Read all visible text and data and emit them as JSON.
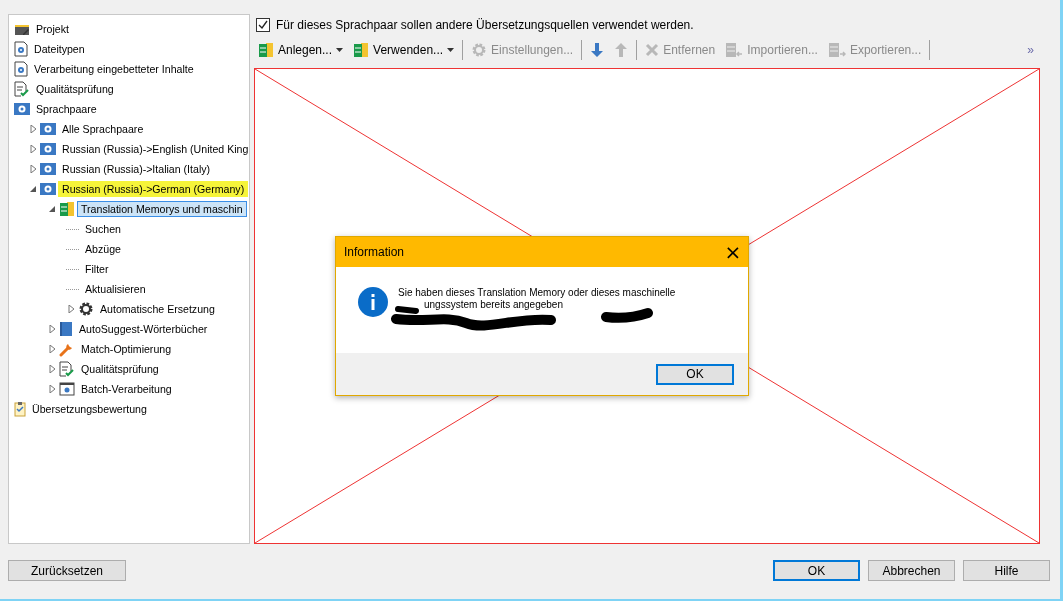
{
  "tree": [
    {
      "label": "Projekt",
      "kind": "project",
      "selected": false
    },
    {
      "label": "Dateitypen",
      "kind": "settings-doc",
      "selected": false
    },
    {
      "label": "Verarbeitung eingebetteter Inhalte",
      "kind": "settings-doc",
      "selected": false
    },
    {
      "label": "Qualitätsprüfung",
      "kind": "check-doc",
      "selected": false
    },
    {
      "label": "Sprachpaare",
      "kind": "pair",
      "selected": false,
      "children": [
        {
          "label": "Alle Sprachpaare",
          "kind": "pair",
          "expanded": false,
          "selected": false,
          "highlighted": false
        },
        {
          "label": "Russian (Russia)->English (United King",
          "kind": "pair",
          "expanded": false,
          "selected": false,
          "highlighted": false
        },
        {
          "label": "Russian (Russia)->Italian (Italy)",
          "kind": "pair",
          "expanded": false,
          "selected": false,
          "highlighted": false
        },
        {
          "label": "Russian (Russia)->German (Germany)",
          "kind": "pair",
          "expanded": true,
          "selected": false,
          "highlighted": true,
          "children": [
            {
              "label": "Translation Memorys und maschin",
              "kind": "tm",
              "expanded": true,
              "selected": true,
              "children": [
                {
                  "label": "Suchen",
                  "kind": "leaf",
                  "selected": false
                },
                {
                  "label": "Abzüge",
                  "kind": "leaf",
                  "selected": false
                },
                {
                  "label": "Filter",
                  "kind": "leaf",
                  "selected": false
                },
                {
                  "label": "Aktualisieren",
                  "kind": "leaf",
                  "selected": false
                },
                {
                  "label": "Automatische Ersetzung",
                  "kind": "gear",
                  "expanded": false,
                  "selected": false
                }
              ]
            },
            {
              "label": "AutoSuggest-Wörterbücher",
              "kind": "book",
              "expanded": false,
              "selected": false
            },
            {
              "label": "Match-Optimierung",
              "kind": "wrench",
              "expanded": false,
              "selected": false
            },
            {
              "label": "Qualitätsprüfung",
              "kind": "check-doc",
              "expanded": false,
              "selected": false
            },
            {
              "label": "Batch-Verarbeitung",
              "kind": "batch",
              "expanded": false,
              "selected": false
            }
          ]
        }
      ]
    },
    {
      "label": "Übersetzungsbewertung",
      "kind": "clipboard",
      "selected": false
    }
  ],
  "override": {
    "label": "Für dieses Sprachpaar sollen andere Übersetzungsquellen verwendet werden.",
    "checked": true
  },
  "toolbar": [
    {
      "kind": "tm",
      "label": "Anlegen...",
      "dropdown": true,
      "disabled": false
    },
    {
      "kind": "tm",
      "label": "Verwenden...",
      "dropdown": true,
      "disabled": false
    },
    {
      "kind": "gear",
      "label": "Einstellungen...",
      "dropdown": false,
      "disabled": true
    },
    {
      "kind": "down",
      "dropdown": false,
      "disabled": false
    },
    {
      "kind": "up",
      "dropdown": false,
      "disabled": true
    },
    {
      "kind": "remove",
      "label": "Entfernen",
      "dropdown": false,
      "disabled": true
    },
    {
      "kind": "import",
      "label": "Importieren...",
      "dropdown": false,
      "disabled": true
    },
    {
      "kind": "export",
      "label": "Exportieren...",
      "dropdown": false,
      "disabled": true
    }
  ],
  "toolbar_overflow": "»",
  "dialog": {
    "title": "Information",
    "close": "×",
    "line_1": "Sie haben dieses Translation Memory oder dieses maschinelle",
    "line_2": "ungssystem bereits angegeben",
    "button": "OK"
  },
  "left_button": "Zurücksetzen",
  "buttons": [
    {
      "label": "OK",
      "default": true
    },
    {
      "label": "Abbrechen",
      "default": false
    },
    {
      "label": "Hilfe",
      "default": false
    }
  ]
}
